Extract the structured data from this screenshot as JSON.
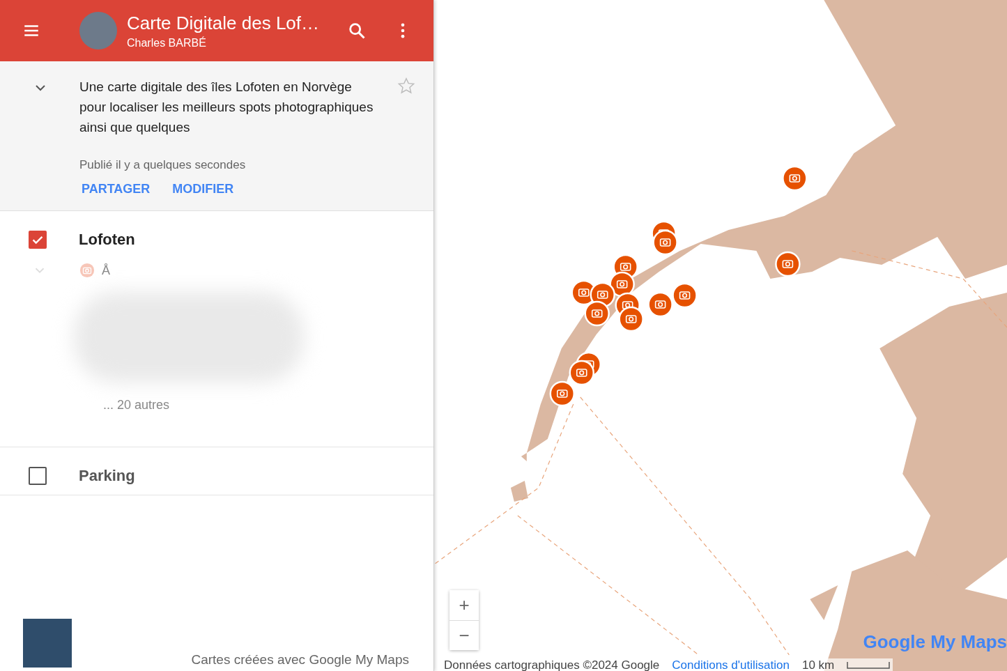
{
  "header": {
    "title": "Carte Digitale des Lof…",
    "author": "Charles BARBÉ"
  },
  "description": {
    "text": "Une carte digitale des îles Lofoten en Norvège pour localiser les meilleurs spots photographiques ainsi que quelques",
    "expanded": true,
    "starred": false,
    "published": "Publié il y a quelques secondes",
    "actions": [
      "PARTAGER",
      "MODIFIER"
    ]
  },
  "layers": [
    {
      "name": "Lofoten",
      "checked": true,
      "items": [
        {
          "name": "Å"
        }
      ],
      "more": "... 20 autres"
    },
    {
      "name": "Parking",
      "checked": false
    }
  ],
  "footer": "Cartes créées avec Google My Maps",
  "map": {
    "zoom_in": "+",
    "zoom_out": "−",
    "attribution": "Données cartographiques ©2024 Google",
    "terms": "Conditions d'utilisation",
    "scale": "10 km",
    "logo": "Google My Maps"
  }
}
